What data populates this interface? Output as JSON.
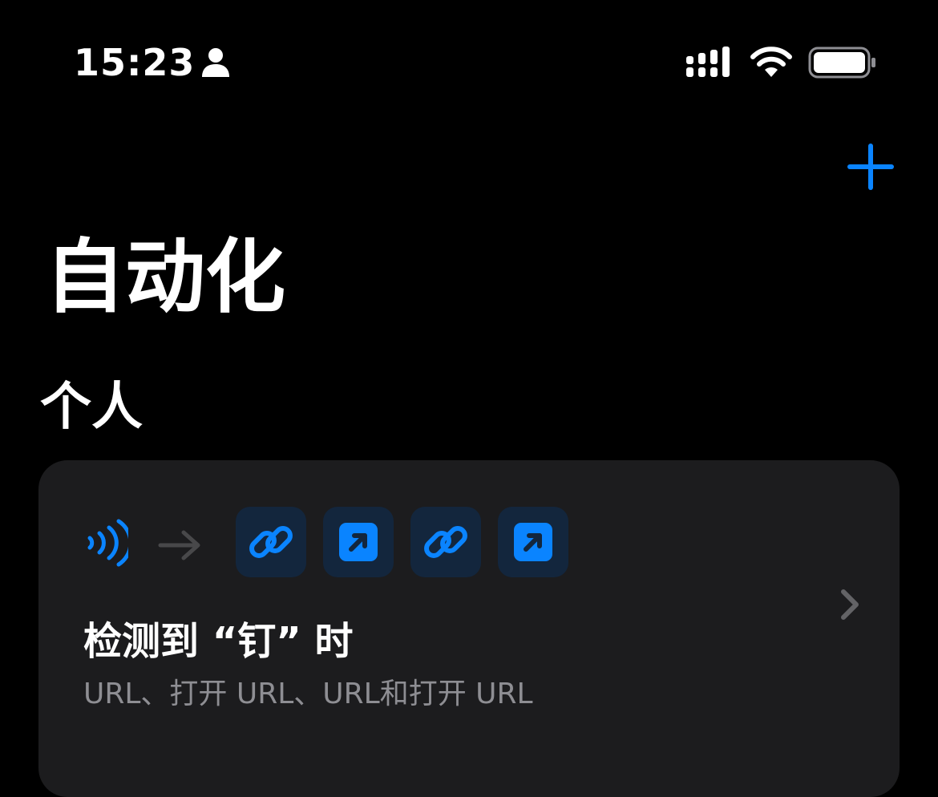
{
  "status_bar": {
    "time": "15:23",
    "person_icon": "person-fill-icon",
    "signal_icon": "cellular-signal-icon",
    "wifi_icon": "wifi-icon",
    "battery_icon": "battery-full-icon"
  },
  "header": {
    "add_icon": "plus-icon",
    "title": "自动化"
  },
  "section": {
    "label": "个人"
  },
  "automation": {
    "trigger_icon": "nfc-icon",
    "flow_icon": "arrow-right-icon",
    "actions": [
      {
        "icon": "link-icon"
      },
      {
        "icon": "open-url-icon"
      },
      {
        "icon": "link-icon"
      },
      {
        "icon": "open-url-icon"
      }
    ],
    "title": "检测到 “钉” 时",
    "subtitle": "URL、打开 URL、URL和打开 URL",
    "chevron_icon": "chevron-right-icon"
  },
  "colors": {
    "background": "#000000",
    "accent": "#0a84ff",
    "card": "#1c1c1e",
    "action_tile": "#13263d",
    "secondary_text": "#8e8e93"
  }
}
